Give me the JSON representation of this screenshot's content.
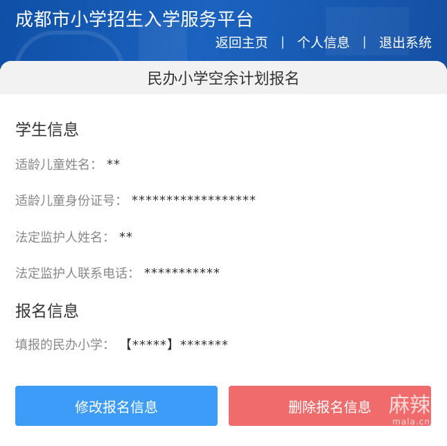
{
  "header": {
    "title": "成都市小学招生入学服务平台",
    "nav": {
      "home": "返回主页",
      "profile": "个人信息",
      "logout": "退出系统",
      "separator": "|"
    }
  },
  "card": {
    "title": "民办小学空余计划报名"
  },
  "student_info": {
    "section_title": "学生信息",
    "fields": [
      {
        "label": "适龄儿童姓名：",
        "value": "**"
      },
      {
        "label": "适龄儿童身份证号：",
        "value": "******************"
      },
      {
        "label": "法定监护人姓名：",
        "value": "**"
      },
      {
        "label": "法定监护人联系电话：",
        "value": "***********"
      }
    ]
  },
  "registration_info": {
    "section_title": "报名信息",
    "fields": [
      {
        "label": "填报的民办小学：",
        "value": "【*****】*******"
      }
    ]
  },
  "actions": {
    "edit_label": "修改报名信息",
    "delete_label": "删除报名信息"
  },
  "watermark": {
    "main": "麻辣",
    "sub": "mala.cn"
  },
  "colors": {
    "header_bg": "#1b63bf",
    "edit_button": "#3d9cf7",
    "delete_button": "#f06b6b"
  }
}
